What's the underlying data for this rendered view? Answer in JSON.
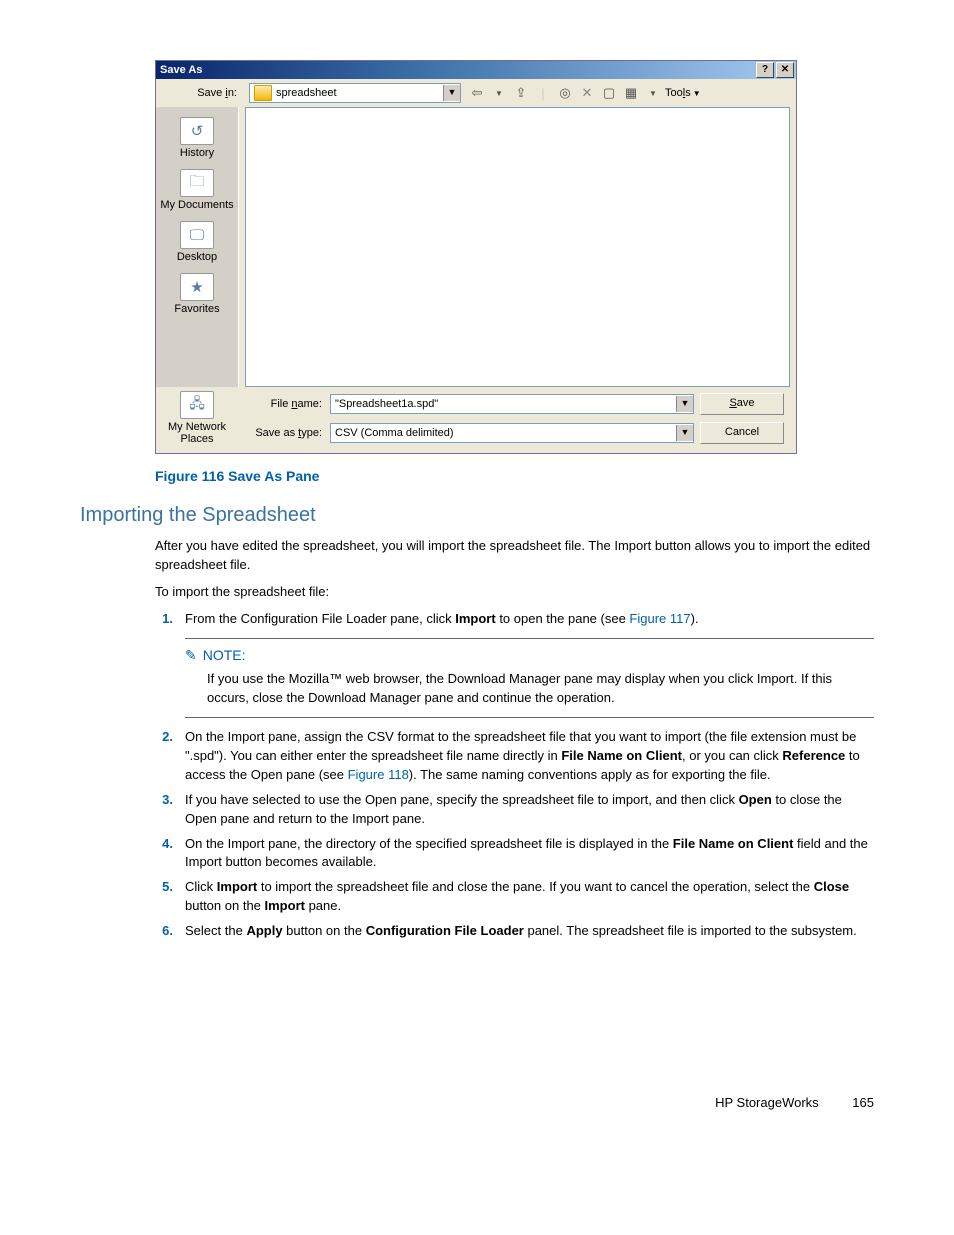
{
  "dialog": {
    "title": "Save As",
    "help_btn": "?",
    "close_btn": "✕",
    "save_in_label": "Save in:",
    "save_in_value": "spreadsheet",
    "tools_label": "Tools",
    "places": {
      "history": "History",
      "my_documents": "My Documents",
      "desktop": "Desktop",
      "favorites": "Favorites",
      "network": "My Network Places"
    },
    "filename_label": "File name:",
    "filename_value": "\"Spreadsheet1a.spd\"",
    "savetype_label": "Save as type:",
    "savetype_value": "CSV (Comma delimited)",
    "save_btn": "Save",
    "cancel_btn": "Cancel"
  },
  "figure_caption": "Figure 116 Save As Pane",
  "section_heading": "Importing the Spreadsheet",
  "intro_para": "After you have edited the spreadsheet, you will import the spreadsheet file. The Import button allows you to import the edited spreadsheet file.",
  "lead_in": "To import the spreadsheet file:",
  "steps": {
    "s1_a": "From the Configuration File Loader pane, click ",
    "s1_bold": "Import",
    "s1_b": " to open the pane (see ",
    "s1_link": "Figure 117",
    "s1_c": ").",
    "s2_a": "On the Import pane, assign the CSV format to the spreadsheet file that you want to import (the file extension must be \".spd\"). You can either enter the spreadsheet file name directly in ",
    "s2_b1": "File Name on Client",
    "s2_b": ", or you can click ",
    "s2_b2": "Reference",
    "s2_c": " to access the Open pane (see ",
    "s2_link": "Figure 118",
    "s2_d": "). The same naming conventions apply as for exporting the file.",
    "s3_a": "If you have selected to use the Open pane, specify the spreadsheet file to import, and then click ",
    "s3_b1": "Open",
    "s3_b": " to close the Open pane and return to the Import pane.",
    "s4_a": "On the Import pane, the directory of the specified spreadsheet file is displayed in the ",
    "s4_b1": "File Name on Client",
    "s4_b": " field and the Import button becomes available.",
    "s5_a": "Click ",
    "s5_b1": "Import",
    "s5_b": " to import the spreadsheet file and close the pane. If you want to cancel the operation, select the ",
    "s5_b2": "Close",
    "s5_c": " button on the ",
    "s5_b3": "Import",
    "s5_d": " pane.",
    "s6_a": "Select the ",
    "s6_b1": "Apply",
    "s6_b": " button on the ",
    "s6_b2": "Configuration File Loader",
    "s6_c": " panel. The spreadsheet file is imported to the subsystem."
  },
  "note": {
    "label": "NOTE:",
    "text": "If you use the Mozilla™ web browser, the Download Manager pane may display when you click Import. If this occurs, close the Download Manager pane and continue the operation."
  },
  "footer": {
    "product": "HP StorageWorks",
    "page": "165"
  }
}
